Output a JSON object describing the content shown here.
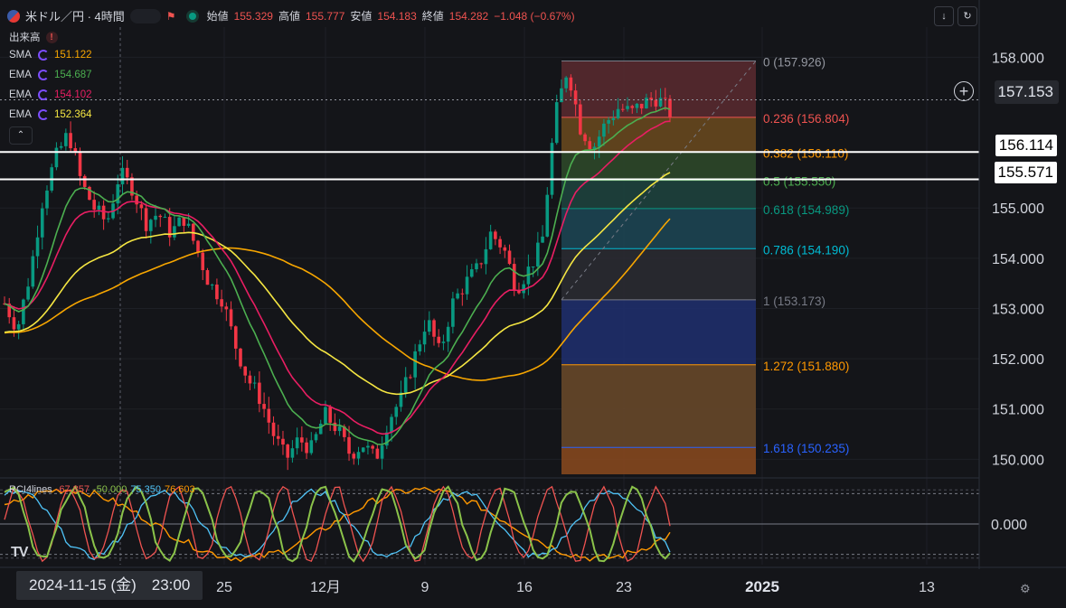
{
  "header": {
    "symbol_title": "米ドル／円 · 4時間",
    "open_label": "始値",
    "open": "155.329",
    "high_label": "高値",
    "high": "155.777",
    "low_label": "安値",
    "low": "154.183",
    "close_label": "終値",
    "close": "154.282",
    "change": "−1.048 (−0.67%)"
  },
  "indicators": {
    "volume_label": "出来高",
    "items": [
      {
        "name": "SMA",
        "value": "151.122",
        "color": "#f7a600"
      },
      {
        "name": "EMA",
        "value": "154.687",
        "color": "#4caf50"
      },
      {
        "name": "EMA",
        "value": "154.102",
        "color": "#e91e63"
      },
      {
        "name": "EMA",
        "value": "152.364",
        "color": "#f5e642"
      }
    ]
  },
  "price_axis": {
    "ticks": [
      "158.000",
      "157.153",
      "155.000",
      "154.000",
      "153.000",
      "152.000",
      "151.000",
      "150.000"
    ],
    "current_price": "157.153",
    "horizontal_line_1": "156.114",
    "horizontal_line_2": "155.571"
  },
  "time_axis": {
    "labels": [
      "25",
      "12月",
      "9",
      "16",
      "23",
      "2025",
      "13"
    ],
    "crosshair_date": "2024-11-15 (金)　23:00"
  },
  "fibonacci": [
    {
      "label": "0 (157.926)",
      "color": "#9598a1"
    },
    {
      "label": "0.236 (156.804)",
      "color": "#ef5350"
    },
    {
      "label": "0.382 (156.110)",
      "color": "#ff9800"
    },
    {
      "label": "0.5 (155.550)",
      "color": "#4caf50"
    },
    {
      "label": "0.618 (154.989)",
      "color": "#089981"
    },
    {
      "label": "0.786 (154.190)",
      "color": "#00bcd4"
    },
    {
      "label": "1 (153.173)",
      "color": "#787b86"
    },
    {
      "label": "1.272 (151.880)",
      "color": "#ff9800"
    },
    {
      "label": "1.618 (150.235)",
      "color": "#2962ff"
    }
  ],
  "rci": {
    "title": "RCI4lines",
    "values": [
      {
        "value": "-67.857",
        "color": "#ef5350"
      },
      {
        "value": "-50.000",
        "color": "#8bc34a"
      },
      {
        "value": "75.350",
        "color": "#4fc3f7"
      },
      {
        "value": "76.603",
        "color": "#ff9800"
      }
    ],
    "axis_tick": "0.000"
  },
  "chart_data": {
    "type": "candlestick",
    "title": "米ドル／円 · 4時間",
    "ylim": [
      149.7,
      158.6
    ],
    "y_ticks": [
      150,
      151,
      152,
      153,
      154,
      155,
      158
    ],
    "horizontal_lines": [
      156.114,
      155.571
    ],
    "current_price": 157.153,
    "x_labels": [
      "25",
      "12月",
      "9",
      "16",
      "23",
      "2025",
      "13"
    ],
    "series": [
      {
        "name": "SMA",
        "last": 151.122
      },
      {
        "name": "EMA",
        "last": 154.687
      },
      {
        "name": "EMA",
        "last": 154.102
      },
      {
        "name": "EMA",
        "last": 152.364
      }
    ],
    "price_path": [
      153.1,
      152.6,
      153.7,
      155.2,
      156.0,
      156.5,
      155.5,
      155.0,
      154.7,
      155.7,
      155.4,
      154.7,
      154.9,
      154.5,
      154.8,
      154.2,
      153.5,
      153.2,
      152.3,
      151.6,
      151.2,
      150.5,
      150.0,
      150.4,
      150.2,
      150.9,
      150.6,
      150.1,
      150.3,
      150.0,
      150.8,
      151.2,
      152.0,
      152.8,
      152.1,
      153.1,
      153.5,
      153.8,
      154.5,
      154.2,
      153.4,
      153.8,
      154.3,
      156.8,
      157.8,
      156.6,
      156.2,
      156.7,
      157.0,
      156.9,
      157.1,
      157.2,
      156.9
    ]
  }
}
